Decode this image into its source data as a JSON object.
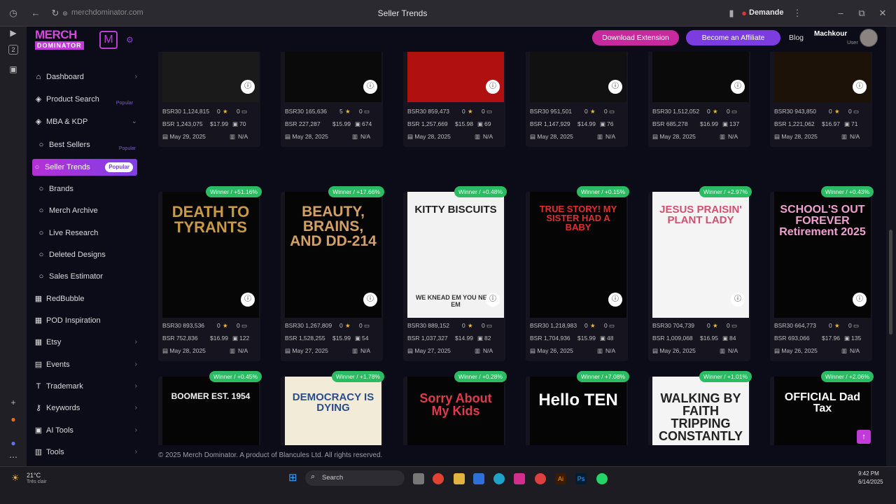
{
  "browser": {
    "url": "merchdominator.com",
    "title": "Seller Trends",
    "profile": "Demande"
  },
  "app": {
    "logo_line1": "MERCH",
    "logo_line2": "DOMINATOR",
    "accent": "#c13bd8"
  },
  "header": {
    "download_btn": "Download Extension",
    "affiliate_btn": "Become an Affiliate",
    "blog": "Blog",
    "user_name": "Machkour",
    "user_role": "User"
  },
  "sidebar": {
    "items": [
      {
        "label": "Dashboard",
        "icon": "home-icon",
        "chevron": "›"
      },
      {
        "label": "Product Search",
        "icon": "cube-icon",
        "tag": "Popular"
      },
      {
        "label": "MBA & KDP",
        "icon": "cube-icon",
        "chevron": "⌄"
      },
      {
        "label": "Best Sellers",
        "tag": "Popular"
      },
      {
        "label": "Seller Trends",
        "tag": "Popular"
      },
      {
        "label": "Brands"
      },
      {
        "label": "Merch Archive"
      },
      {
        "label": "Live Research"
      },
      {
        "label": "Deleted Designs"
      },
      {
        "label": "Sales Estimator"
      },
      {
        "label": "RedBubble",
        "icon": "store-icon"
      },
      {
        "label": "POD Inspiration",
        "icon": "store-icon"
      },
      {
        "label": "Etsy",
        "icon": "store-icon",
        "chevron": "›"
      },
      {
        "label": "Events",
        "icon": "calendar-icon",
        "chevron": "›"
      },
      {
        "label": "Trademark",
        "icon": "t-icon",
        "chevron": "›"
      },
      {
        "label": "Keywords",
        "icon": "key-icon",
        "chevron": "›"
      },
      {
        "label": "AI Tools",
        "icon": "ai-icon",
        "chevron": "›"
      },
      {
        "label": "Tools",
        "icon": "tools-icon",
        "chevron": "›"
      }
    ]
  },
  "row1": [
    {
      "bsr30": "BSR30 1,124,815",
      "rating": "0",
      "reviews": "0",
      "bsr": "BSR 1,243,075",
      "price": "$17.99",
      "sold": "70",
      "date": "May 29, 2025",
      "na": "N/A"
    },
    {
      "bsr30": "BSR30 165,636",
      "rating": "5",
      "reviews": "0",
      "bsr": "BSR 227,287",
      "price": "$15.99",
      "sold": "674",
      "date": "May 28, 2025",
      "na": "N/A"
    },
    {
      "bsr30": "BSR30 859,473",
      "rating": "0",
      "reviews": "0",
      "bsr": "BSR 1,257,669",
      "price": "$15.98",
      "sold": "69",
      "date": "May 28, 2025",
      "na": "N/A"
    },
    {
      "bsr30": "BSR30 951,501",
      "rating": "0",
      "reviews": "0",
      "bsr": "BSR 1,147,929",
      "price": "$14.99",
      "sold": "76",
      "date": "May 28, 2025",
      "na": "N/A"
    },
    {
      "bsr30": "BSR30 1,512,052",
      "rating": "0",
      "reviews": "0",
      "bsr": "BSR 685,278",
      "price": "$16.99",
      "sold": "137",
      "date": "May 28, 2025",
      "na": "N/A"
    },
    {
      "bsr30": "BSR30 943,850",
      "rating": "0",
      "reviews": "0",
      "bsr": "BSR 1,221,062",
      "price": "$16.97",
      "sold": "71",
      "date": "May 28, 2025",
      "na": "N/A"
    }
  ],
  "row2": [
    {
      "badge": "Winner / +51.16%",
      "design": "DEATH TO TYRANTS",
      "bsr30": "BSR30 893,536",
      "rating": "0",
      "reviews": "0",
      "bsr": "BSR 752,836",
      "price": "$16.99",
      "sold": "122",
      "date": "May 28, 2025",
      "na": "N/A"
    },
    {
      "badge": "Winner / +17.66%",
      "design": "BEAUTY, BRAINS, AND DD-214",
      "bsr30": "BSR30 1,267,809",
      "rating": "0",
      "reviews": "0",
      "bsr": "BSR 1,528,255",
      "price": "$15.99",
      "sold": "54",
      "date": "May 27, 2025",
      "na": "N/A"
    },
    {
      "badge": "Winner / +0.48%",
      "design": "KITTY BISCUITS",
      "design2": "WE KNEAD EM YOU NEED EM",
      "bsr30": "BSR30 889,152",
      "rating": "0",
      "reviews": "0",
      "bsr": "BSR 1,037,327",
      "price": "$14.99",
      "sold": "82",
      "date": "May 27, 2025",
      "na": "N/A"
    },
    {
      "badge": "Winner / +0.15%",
      "design": "TRUE STORY! MY SISTER HAD A BABY",
      "bsr30": "BSR30 1,218,983",
      "rating": "0",
      "reviews": "0",
      "bsr": "BSR 1,704,936",
      "price": "$15.99",
      "sold": "48",
      "date": "May 26, 2025",
      "na": "N/A"
    },
    {
      "badge": "Winner / +2.97%",
      "design": "JESUS PRAISIN' PLANT LADY",
      "bsr30": "BSR30 704,739",
      "rating": "0",
      "reviews": "0",
      "bsr": "BSR 1,009,068",
      "price": "$16.95",
      "sold": "84",
      "date": "May 26, 2025",
      "na": "N/A"
    },
    {
      "badge": "Winner / +0.43%",
      "design": "SCHOOL'S OUT FOREVER Retirement 2025",
      "bsr30": "BSR30 664,773",
      "rating": "0",
      "reviews": "0",
      "bsr": "BSR 693,066",
      "price": "$17.96",
      "sold": "135",
      "date": "May 26, 2025",
      "na": "N/A"
    }
  ],
  "row3": [
    {
      "badge": "Winner / +0.45%",
      "design": "BOOMER EST. 1954"
    },
    {
      "badge": "Winner / +1.78%",
      "design": "DEMOCRACY IS DYING"
    },
    {
      "badge": "Winner / +0.28%",
      "design": "Sorry About My Kids"
    },
    {
      "badge": "Winner / +7.08%",
      "design": "Hello TEN"
    },
    {
      "badge": "Winner / +1.01%",
      "design": "WALKING BY FAITH TRIPPING CONSTANTLY"
    },
    {
      "badge": "Winner / +2.06%",
      "design": "OFFICIAL Dad Tax"
    }
  ],
  "footer": "© 2025 Merch Dominator. A product of Blancules Ltd. All rights reserved.",
  "taskbar": {
    "temp": "21°C",
    "weather": "Très clair",
    "search": "Search",
    "time": "9:42 PM",
    "date": "6/14/2025"
  }
}
